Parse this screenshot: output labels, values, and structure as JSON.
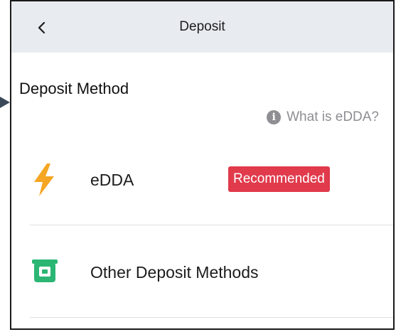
{
  "header": {
    "title": "Deposit",
    "back_icon": "chevron-left-icon"
  },
  "section": {
    "title": "Deposit Method"
  },
  "help": {
    "icon": "info-icon",
    "label": "What is eDDA?"
  },
  "methods": [
    {
      "label": "eDDA",
      "icon": "lightning-bolt-icon",
      "badge": "Recommended",
      "icon_color": "#f5a623"
    },
    {
      "label": "Other Deposit Methods",
      "icon": "cash-bill-icon",
      "icon_color": "#2bb673"
    }
  ],
  "colors": {
    "header_bg": "#e8ebef",
    "badge_bg": "#e03a4b",
    "muted_text": "#8e8e93"
  }
}
